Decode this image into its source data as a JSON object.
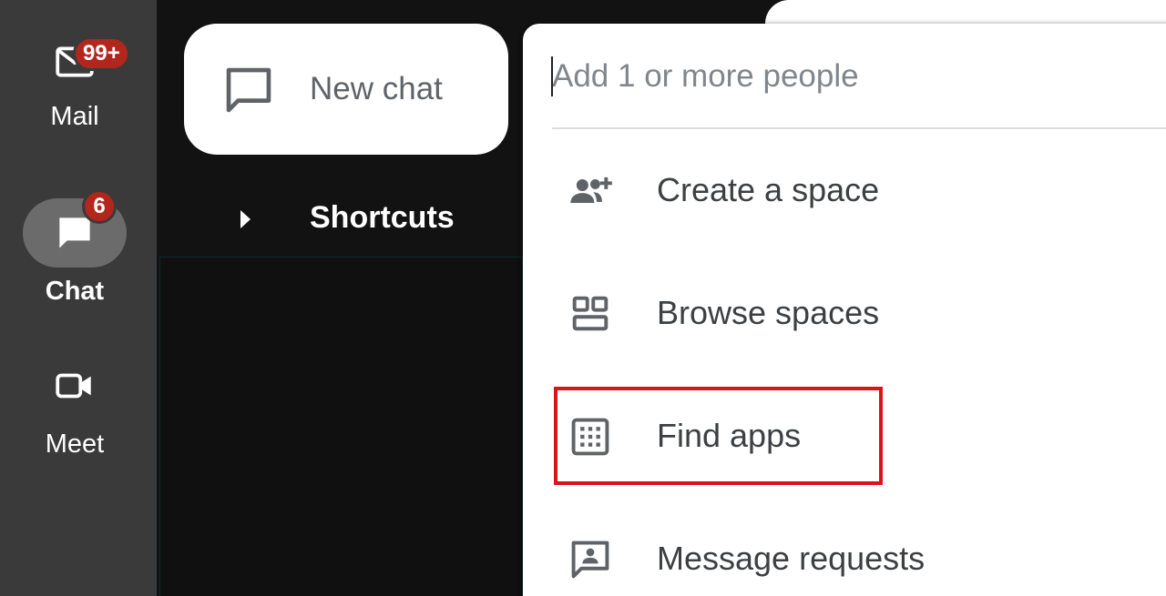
{
  "rail": {
    "items": [
      {
        "label": "Mail",
        "icon": "mail-icon",
        "badge": "99+"
      },
      {
        "label": "Chat",
        "icon": "chat-bubble-icon",
        "badge": "6",
        "active": true
      },
      {
        "label": "Meet",
        "icon": "video-camera-icon"
      }
    ]
  },
  "new_chat": {
    "label": "New chat",
    "icon": "new-chat-icon"
  },
  "shortcuts": {
    "label": "Shortcuts"
  },
  "menu": {
    "people_placeholder": "Add 1 or more people",
    "items": [
      {
        "label": "Create a space",
        "icon": "group-add-icon"
      },
      {
        "label": "Browse spaces",
        "icon": "browse-grid-icon"
      },
      {
        "label": "Find apps",
        "icon": "apps-grid-icon",
        "highlighted": true
      },
      {
        "label": "Message requests",
        "icon": "message-request-icon"
      }
    ]
  },
  "colors": {
    "rail_bg": "#3a3a3a",
    "app_bg": "#121212",
    "badge": "#b3261e",
    "highlight_box": "#d9141b",
    "menu_text": "#3c4043",
    "placeholder": "#80868b"
  }
}
